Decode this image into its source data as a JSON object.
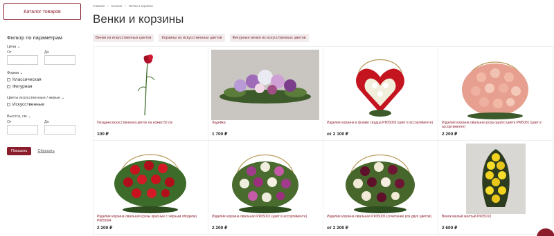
{
  "catalog_button": "Каталог товаров",
  "filter": {
    "title": "Фильтр по параметрам",
    "price_label": "Цена ⌄",
    "price_from": "От",
    "price_to": "До",
    "shape_label": "Форма ⌄",
    "shape_options": [
      "Классическая",
      "Фигурная"
    ],
    "colors_label": "Цветы искусственные / живые ⌄",
    "colors_options": [
      "Искусственные"
    ],
    "height_label": "Высота, см ⌄",
    "height_from": "От",
    "height_to": "До",
    "show_label": "Показать",
    "reset_label": "Сбросить"
  },
  "breadcrumb": [
    "Главная",
    "Каталог",
    "Венки и корзины"
  ],
  "page_title": "Венки и корзины",
  "chips": [
    "Венки из искусственных цветов",
    "Корзины из искусственных цветов",
    "Фигурные венки из искусственных цветов"
  ],
  "products": [
    {
      "name": "Гвоздика искусственная цветок на ножке 50 см",
      "price": "100 ₽",
      "image": "carnation-image"
    },
    {
      "name": "Ладейка",
      "price": "1 700 ₽",
      "image": "boat-arrangement-image"
    },
    {
      "name": "Изделие корзина в форме сердца РК05003 (цвет в ассортименте)",
      "price": "от 2 100 ₽",
      "image": "heart-basket-image"
    },
    {
      "name": "Изделие корзина овальная роза одного цвета РМ5001 (цвет в ассортименте)",
      "price": "2 200 ₽",
      "image": "pink-roses-basket-image"
    },
    {
      "name": "Изделие корзина овальная (розы красные с чёрным ободком) РК05004",
      "price": "2 200 ₽",
      "image": "red-roses-basket-image"
    },
    {
      "name": "Изделие корзина овальная РК05001 (цвет в ассортименте)",
      "price": "2 200 ₽",
      "image": "mixed-roses-basket-image"
    },
    {
      "name": "Изделие корзина овальная РК05005 (сочетание роз двух цветов)",
      "price": "от 2 200 ₽",
      "image": "burgundy-roses-basket-image"
    },
    {
      "name": "Венок малый желтый РК05010",
      "price": "2 600 ₽",
      "image": "yellow-wreath-image"
    }
  ],
  "colors": {
    "accent": "#8b1c2c",
    "chip_bg": "#f3ecec"
  }
}
